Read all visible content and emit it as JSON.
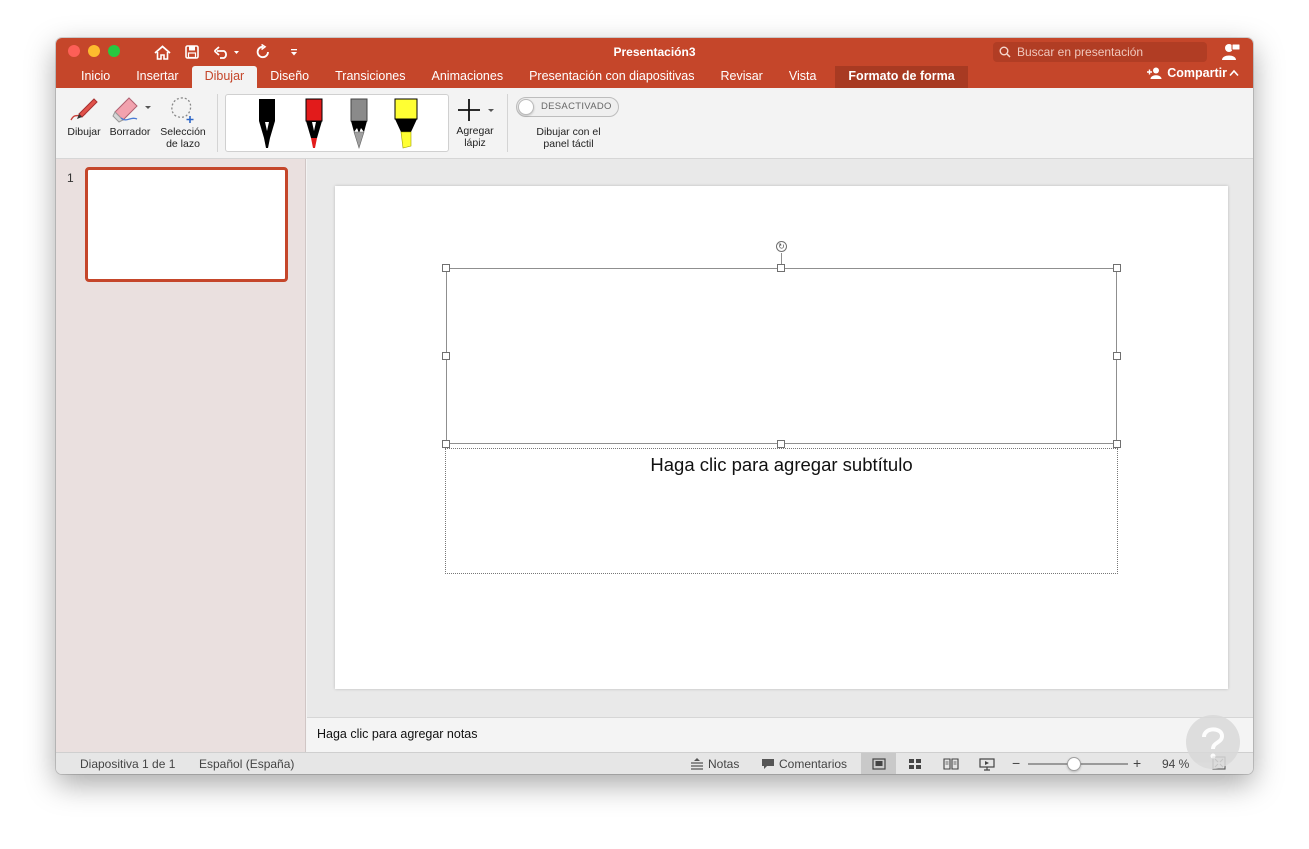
{
  "window": {
    "title": "Presentación3"
  },
  "search": {
    "placeholder": "Buscar en presentación"
  },
  "tabs": [
    "Inicio",
    "Insertar",
    "Dibujar",
    "Diseño",
    "Transiciones",
    "Animaciones",
    "Presentación con diapositivas",
    "Revisar",
    "Vista"
  ],
  "context_tab": "Formato de forma",
  "share_label": "Compartir",
  "ribbon": {
    "draw_label": "Dibujar",
    "eraser_label": "Borrador",
    "lasso_label_1": "Selección",
    "lasso_label_2": "de lazo",
    "add_pen_label_1": "Agregar",
    "add_pen_label_2": "lápiz",
    "pens": [
      {
        "name": "black-pen",
        "color": "#000000"
      },
      {
        "name": "red-pen",
        "color": "#e21b1b"
      },
      {
        "name": "gray-pencil",
        "color": "#8a8a8a"
      },
      {
        "name": "yellow-highlighter",
        "color": "#ffff33"
      }
    ],
    "toggle_state": "DESACTIVADO",
    "toggle_label_1": "Dibujar con el",
    "toggle_label_2": "panel táctil"
  },
  "thumbnails": {
    "slide_number": "1"
  },
  "slide": {
    "subtitle_placeholder": "Haga clic para agregar subtítulo"
  },
  "notes": {
    "placeholder": "Haga clic para agregar notas"
  },
  "statusbar": {
    "slide_info": "Diapositiva 1 de 1",
    "language": "Español (España)",
    "notes_label": "Notas",
    "comments_label": "Comentarios",
    "zoom_level": "94 %",
    "zoom_minus": "−",
    "zoom_plus": "+"
  },
  "colors": {
    "accent": "#c5462a"
  }
}
